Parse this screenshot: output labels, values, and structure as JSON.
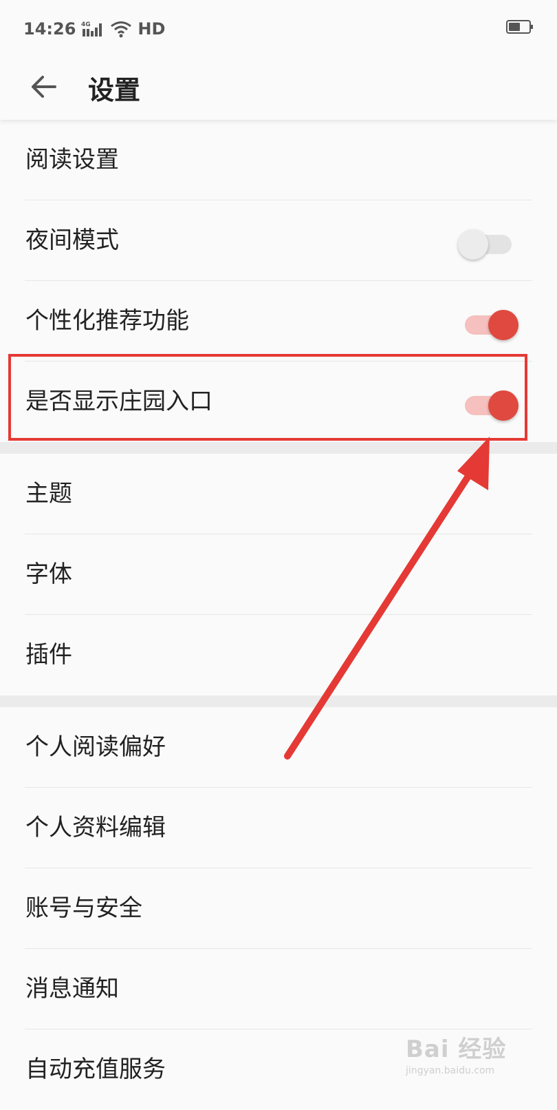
{
  "status_bar": {
    "time": "14:26",
    "network": "4G",
    "hd": "HD",
    "icons": [
      "signal-icon",
      "wifi-icon",
      "battery-icon"
    ]
  },
  "header": {
    "title": "设置",
    "back_icon": "arrow-left-icon"
  },
  "sections": [
    {
      "items": [
        {
          "label": "阅读设置"
        },
        {
          "label": "夜间模式",
          "toggle": "off"
        },
        {
          "label": "个性化推荐功能",
          "toggle": "on"
        },
        {
          "label": "是否显示庄园入口",
          "toggle": "on",
          "highlighted": true
        }
      ]
    },
    {
      "items": [
        {
          "label": "主题"
        },
        {
          "label": "字体"
        },
        {
          "label": "插件"
        }
      ]
    },
    {
      "items": [
        {
          "label": "个人阅读偏好"
        },
        {
          "label": "个人资料编辑"
        },
        {
          "label": "账号与安全"
        },
        {
          "label": "消息通知"
        },
        {
          "label": "自动充值服务"
        }
      ]
    }
  ],
  "annotation": {
    "highlight_color": "#e53935",
    "arrow_color": "#e53935"
  },
  "watermark": {
    "main": "Bai 经验",
    "sub": "jingyan.baidu.com"
  },
  "colors": {
    "toggle_on": "#e0493f",
    "toggle_off": "#e3e3e3",
    "background": "#fafafa"
  }
}
